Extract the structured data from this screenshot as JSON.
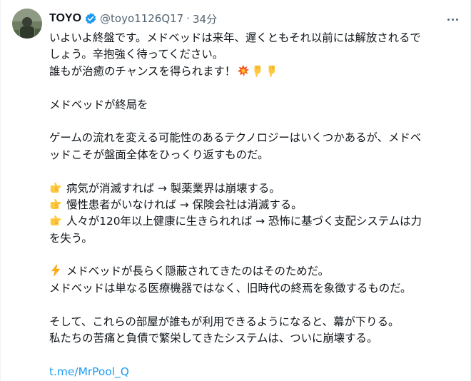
{
  "author": {
    "name": "TOYO",
    "handle": "@toyo1126Q17",
    "separator": "·",
    "time": "34分"
  },
  "tweet": {
    "p1_l1": "いよいよ終盤です。メドベッドは来年、遅くともそれ以前には解放されるで",
    "p1_l2": "しょう。辛抱強く待ってください。",
    "p1_l3": "誰もが治癒のチャンスを得られます！",
    "p2": "メドベッドが終局を",
    "p3_l1": "ゲームの流れを変える可能性のあるテクノロジーはいくつかあるが、メドベ",
    "p3_l2": "ッドこそが盤面全体をひっくり返すものだ。",
    "b1": "病気が消滅すれば → 製薬業界は崩壊する。",
    "b2": "慢性患者がいなければ → 保険会社は消滅する。",
    "b3_l1": "人々が120年以上健康に生きられれば → 恐怖に基づく支配システムは力",
    "b3_l2": "を失う。",
    "p5_l1": "メドベッドが長らく隠蔽されてきたのはそのためだ。",
    "p5_l2": "メドベッドは単なる医療機器ではなく、旧時代の終焉を象徴するものだ。",
    "p6_l1": "そして、これらの部屋が誰もが利用できるようになると、幕が下りる。",
    "p6_l2": "私たちの苦痛と負債で繁栄してきたシステムは、ついに崩壊する。",
    "link": "t.me/MrPool_Q"
  },
  "icons": {
    "verified": "verified-badge-icon",
    "more": "more-options-icon",
    "explosion": "collision-emoji",
    "point_down": "pointing-down-emoji",
    "point_right": "pointing-right-emoji",
    "lightning": "high-voltage-emoji"
  },
  "colors": {
    "text": "#0f1419",
    "secondary": "#536471",
    "link": "#1d9bf0",
    "verified": "#1d9bf0"
  }
}
